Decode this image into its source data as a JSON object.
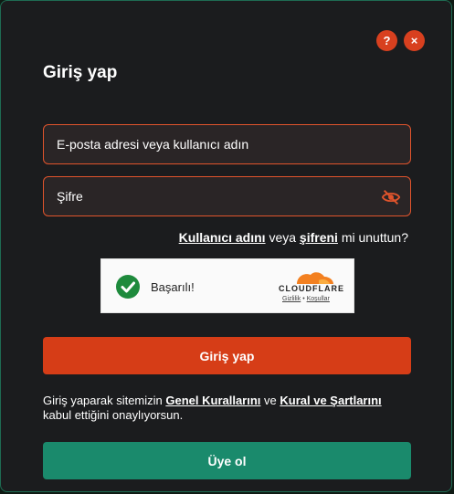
{
  "header": {
    "title": "Giriş yap",
    "help_label": "?",
    "close_label": "×"
  },
  "form": {
    "email_placeholder": "E-posta adresi veya kullanıcı adın",
    "password_placeholder": "Şifre"
  },
  "forgot": {
    "username_link": "Kullanıcı adını",
    "middle": " veya ",
    "password_link": "şifreni",
    "suffix": " mi unuttun?"
  },
  "captcha": {
    "status": "Başarılı!",
    "brand": "CLOUDFLARE",
    "privacy_link": "Gizlilik",
    "separator": "•",
    "terms_link": "Koşullar"
  },
  "login_button": "Giriş yap",
  "terms": {
    "prefix": "Giriş yaparak sitemizin ",
    "rules_link": "Genel Kurallarını",
    "middle": " ve ",
    "conditions_link": "Kural ve Şartlarını",
    "suffix": " kabul ettiğini onaylıyorsun."
  },
  "register_button": "Üye ol",
  "colors": {
    "accent": "#d63d17",
    "register": "#1a8a6c",
    "background": "#1b1c1e"
  }
}
